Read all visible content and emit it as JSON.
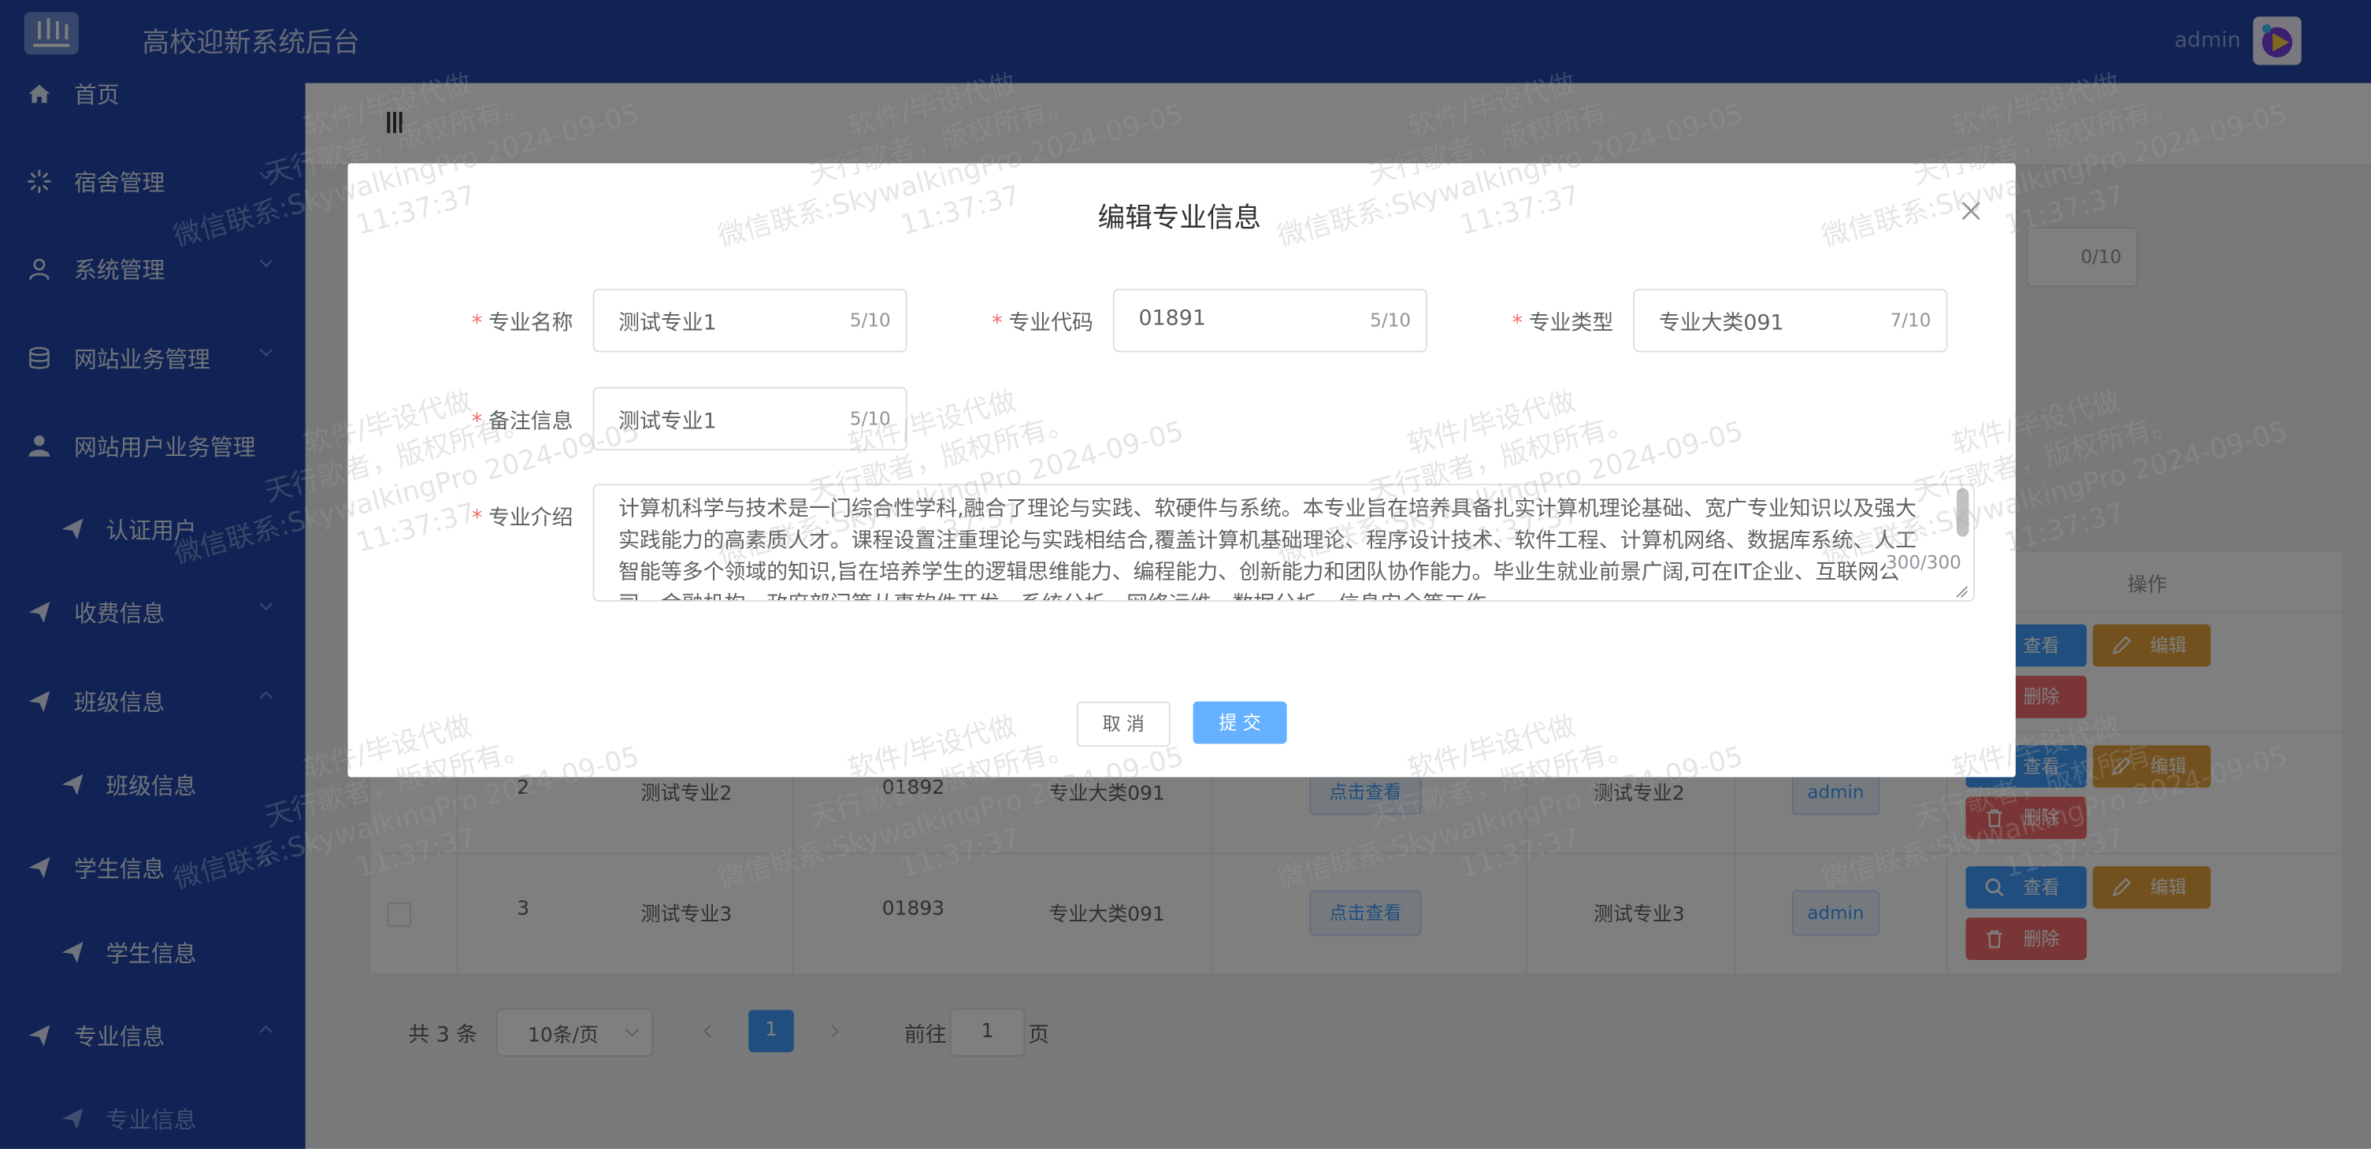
{
  "header": {
    "title": "高校迎新系统后台",
    "user": "admin"
  },
  "sidebar": {
    "items": [
      {
        "label": "首页",
        "icon": "home-icon"
      },
      {
        "label": "宿舍管理",
        "icon": "loading-icon"
      },
      {
        "label": "系统管理",
        "icon": "user-icon"
      },
      {
        "label": "网站业务管理",
        "icon": "database-icon"
      },
      {
        "label": "网站用户业务管理",
        "icon": "user-filled-icon"
      },
      {
        "label": "认证用户",
        "icon": "send-icon"
      },
      {
        "label": "收费信息",
        "icon": "send-icon"
      },
      {
        "label": "班级信息",
        "icon": "send-icon"
      },
      {
        "label": "班级信息",
        "icon": "send-icon"
      },
      {
        "label": "学生信息",
        "icon": "send-icon"
      },
      {
        "label": "学生信息",
        "icon": "send-icon"
      },
      {
        "label": "专业信息",
        "icon": "send-icon"
      },
      {
        "label": "专业信息",
        "icon": "send-icon"
      }
    ]
  },
  "search": {
    "counter": "0/10"
  },
  "table": {
    "ops_header": "操作",
    "rows": [
      {
        "id": "2",
        "name": "测试专业2",
        "code": "01892",
        "type": "专业大类091",
        "detail": "点击查看",
        "note": "测试专业2",
        "user": "admin"
      },
      {
        "id": "3",
        "name": "测试专业3",
        "code": "01893",
        "type": "专业大类091",
        "detail": "点击查看",
        "note": "测试专业3",
        "user": "admin"
      }
    ],
    "actions": {
      "view": "查看",
      "edit": "编辑",
      "delete": "删除"
    }
  },
  "pagination": {
    "total": "共 3 条",
    "page_size": "10条/页",
    "current_page": "1",
    "goto_label": "前往",
    "goto_value": "1",
    "page_suffix": "页"
  },
  "dialog": {
    "title": "编辑专业信息",
    "fields": {
      "name": {
        "label": "专业名称",
        "value": "测试专业1",
        "count": "5/10"
      },
      "code": {
        "label": "专业代码",
        "value": "01891",
        "count": "5/10"
      },
      "type": {
        "label": "专业类型",
        "value": "专业大类091",
        "count": "7/10"
      },
      "note": {
        "label": "备注信息",
        "value": "测试专业1",
        "count": "5/10"
      },
      "intro": {
        "label": "专业介绍",
        "value": " 计算机科学与技术是一门综合性学科,融合了理论与实践、软硬件与系统。本专业旨在培养具备扎实计算机理论基础、宽广专业知识以及强大实践能力的高素质人才。课程设置注重理论与实践相结合,覆盖计算机基础理论、程序设计技术、软件工程、计算机网络、数据库系统、人工智能等多个领域的知识,旨在培养学生的逻辑思维能力、编程能力、创新能力和团队协作能力。毕业生就业前景广阔,可在IT企业、互联网公司、金融机构、政府部门等从事软件开发、系统分析、网络运维、数据分析、信息安全等工作。",
        "count": "300/300"
      }
    },
    "cancel": "取 消",
    "submit": "提 交"
  },
  "watermark": {
    "line1": "软件/毕设代做",
    "line2": "天行歌者，版权所有。",
    "line3": "微信联系:SkywalkingPro 2024-09-05",
    "line4": "11:37:37"
  }
}
